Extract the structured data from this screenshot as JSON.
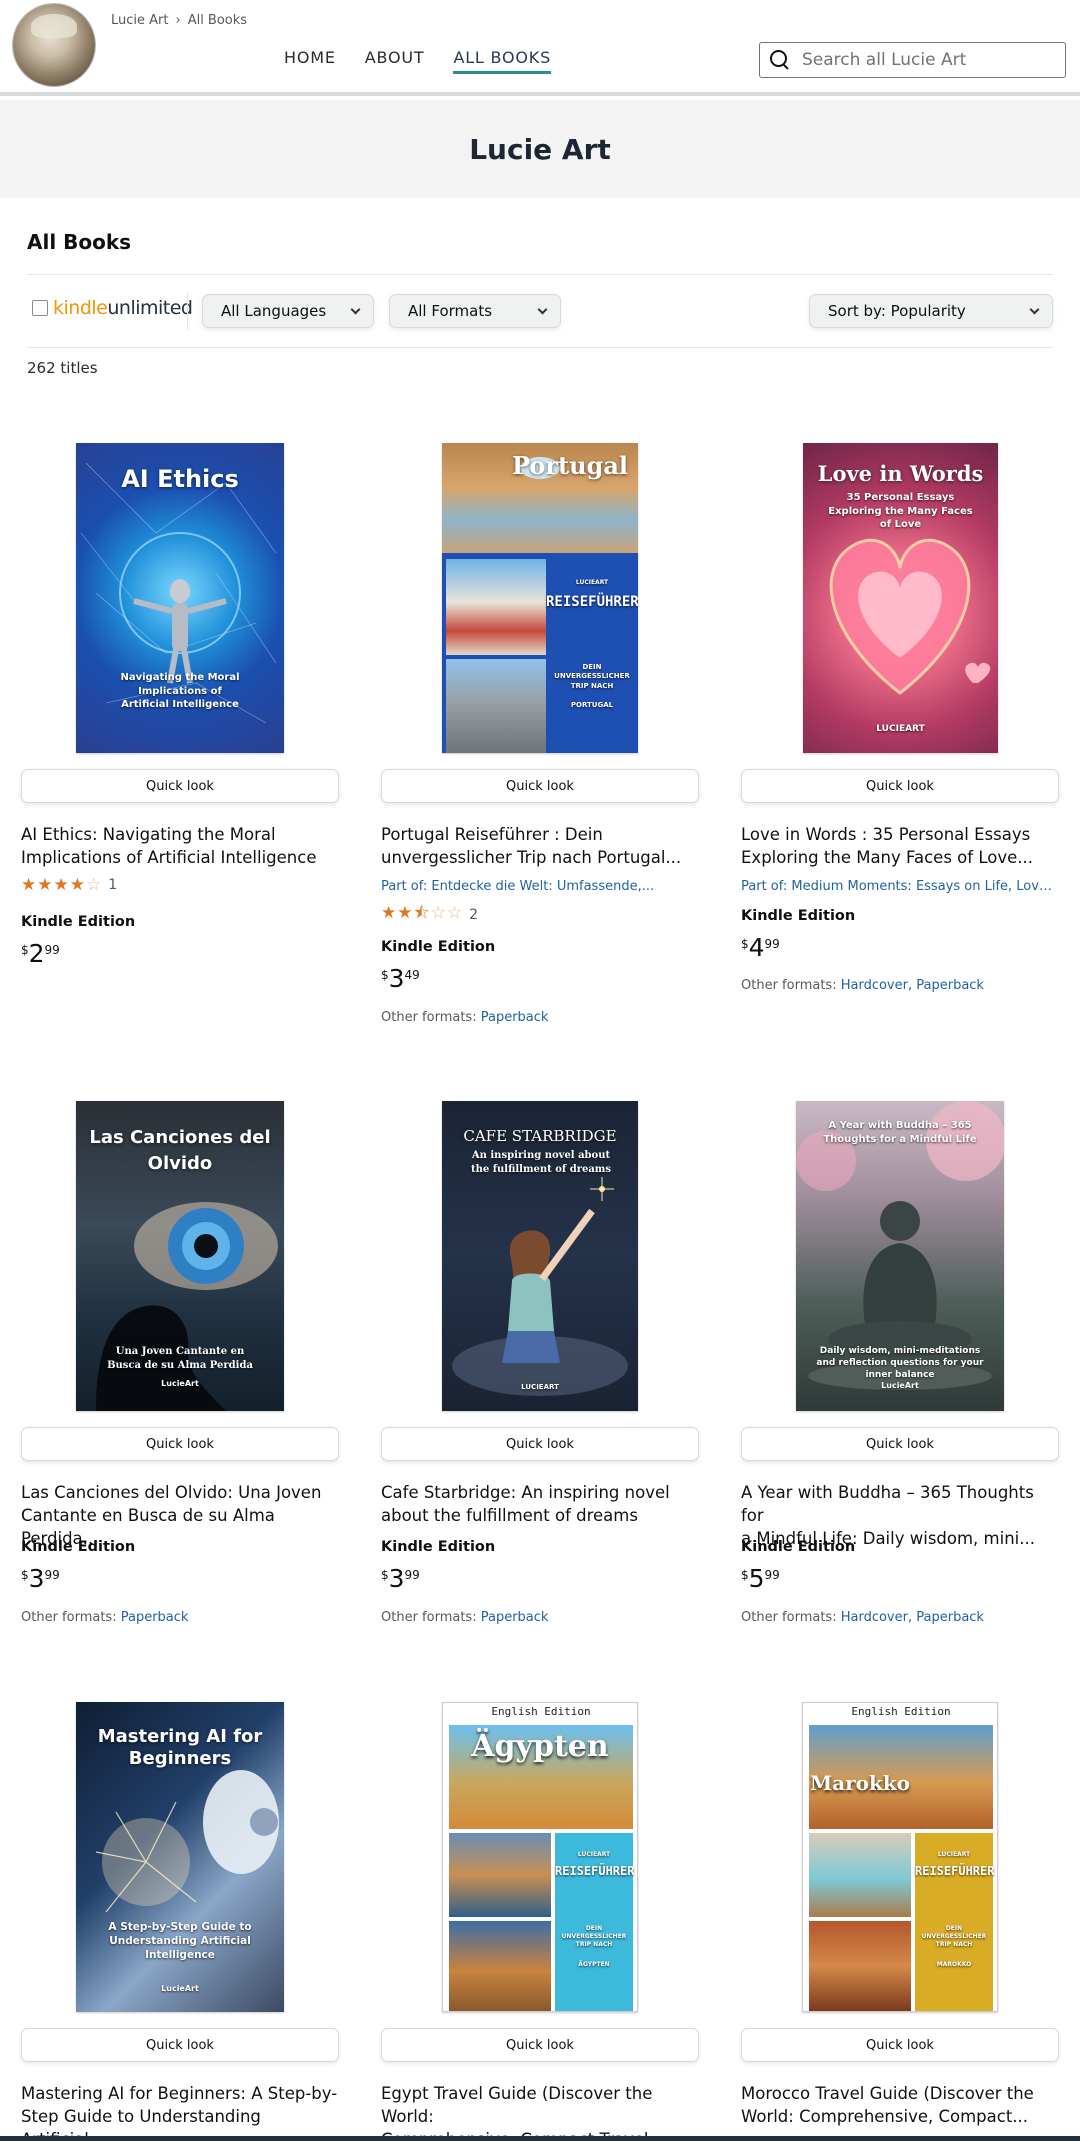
{
  "header": {
    "breadcrumb": [
      "Lucie Art",
      "All Books"
    ],
    "nav": [
      "HOME",
      "ABOUT",
      "ALL BOOKS"
    ],
    "nav_active": "ALL BOOKS",
    "search_placeholder": "Search all Lucie Art"
  },
  "banner_title": "Lucie Art",
  "section_title": "All Books",
  "filters": {
    "kindle_prefix": "kindle",
    "kindle_suffix": "unlimited",
    "language": "All Languages",
    "format": "All Formats",
    "sort": "Sort by: Popularity"
  },
  "titles_count": "262 titles",
  "quick_look_label": "Quick look",
  "books": [
    {
      "title_line1": "AI Ethics: Navigating the Moral",
      "title_line2": "Implications of Artificial Intelligence",
      "cover_title": "AI Ethics",
      "cover_sub": "Navigating the Moral Implications of Artificial Intelligence",
      "rating_value": 4,
      "rating_count": "1",
      "format": "Kindle Edition",
      "price_symbol": "$",
      "price_whole": "2",
      "price_frac": "99"
    },
    {
      "title_line1": "Portugal Reiseführer : Dein",
      "title_line2": "unvergesslicher Trip nach Portugal...",
      "cover_title": "Portugal",
      "cover_sub": "REISEFÜHRER",
      "cover_sub2": "DEIN UNVERGESSLICHER TRIP NACH",
      "cover_sub3": "PORTUGAL",
      "cover_brand": "LUCIEART",
      "series": "Part of: Entdecke die Welt: Umfassende,...",
      "rating_value": 2.5,
      "rating_count": "2",
      "format": "Kindle Edition",
      "price_symbol": "$",
      "price_whole": "3",
      "price_frac": "49",
      "other_label": "Other formats:",
      "other_links": [
        "Paperback"
      ]
    },
    {
      "title_line1": "Love in Words : 35 Personal Essays",
      "title_line2": "Exploring the Many Faces of Love...",
      "cover_title": "Love in Words",
      "cover_sub": "35 Personal Essays Exploring the Many Faces of Love",
      "cover_brand": "LUCIEART",
      "series": "Part of: Medium Moments: Essays on Life, Love...",
      "format": "Kindle Edition",
      "price_symbol": "$",
      "price_whole": "4",
      "price_frac": "99",
      "other_label": "Other formats:",
      "other_links": [
        "Hardcover",
        "Paperback"
      ]
    },
    {
      "title_line1": "Las Canciones del Olvido: Una Joven",
      "title_line2": "Cantante en Busca de su Alma Perdida...",
      "cover_title": "Las Canciones del Olvido",
      "cover_sub": "Una Joven Cantante en Busca de su Alma Perdida",
      "cover_brand": "LucieArt",
      "format": "Kindle Edition",
      "price_symbol": "$",
      "price_whole": "3",
      "price_frac": "99",
      "other_label": "Other formats:",
      "other_links": [
        "Paperback"
      ]
    },
    {
      "title_line1": "Cafe Starbridge: An inspiring novel",
      "title_line2": "about the fulfillment of dreams",
      "cover_title": "CAFE STARBRIDGE",
      "cover_sub": "An inspiring novel about the fulfillment of dreams",
      "cover_brand": "LUCIEART",
      "format": "Kindle Edition",
      "price_symbol": "$",
      "price_whole": "3",
      "price_frac": "99",
      "other_label": "Other formats:",
      "other_links": [
        "Paperback"
      ]
    },
    {
      "title_line1": "A Year with Buddha – 365 Thoughts for",
      "title_line2": "a Mindful Life: Daily wisdom, mini...",
      "cover_title": "A Year with Buddha – 365 Thoughts for a Mindful Life",
      "cover_sub": "Daily wisdom, mini-meditations and reflection questions for your inner balance",
      "cover_brand": "LucieArt",
      "format": "Kindle Edition",
      "price_symbol": "$",
      "price_whole": "5",
      "price_frac": "99",
      "other_label": "Other formats:",
      "other_links": [
        "Hardcover",
        "Paperback"
      ]
    },
    {
      "title_line1": "Mastering AI for Beginners: A Step-by-",
      "title_line2": "Step Guide to Understanding Artificial...",
      "cover_title": "Mastering AI for Beginners",
      "cover_sub": "A Step-by-Step Guide to Understanding Artificial Intelligence",
      "cover_brand": "LucieArt"
    },
    {
      "title_line1": "Egypt Travel Guide (Discover the World:",
      "title_line2": "Comprehensive, Compact Travel...",
      "cover_edition": "English Edition",
      "cover_title": "Ägypten",
      "cover_sub": "REISEFÜHRER",
      "cover_sub2": "DEIN UNVERGESSLICHER TRIP NACH",
      "cover_sub3": "ÄGYPTEN",
      "cover_brand": "LUCIEART"
    },
    {
      "title_line1": "Morocco Travel Guide (Discover the",
      "title_line2": "World: Comprehensive, Compact...",
      "cover_edition": "English Edition",
      "cover_title": "Marokko",
      "cover_sub": "REISEFÜHRER",
      "cover_sub2": "DEIN UNVERGESSLICHER TRIP NACH",
      "cover_sub3": "MAROKKO",
      "cover_brand": "LUCIEART"
    }
  ]
}
